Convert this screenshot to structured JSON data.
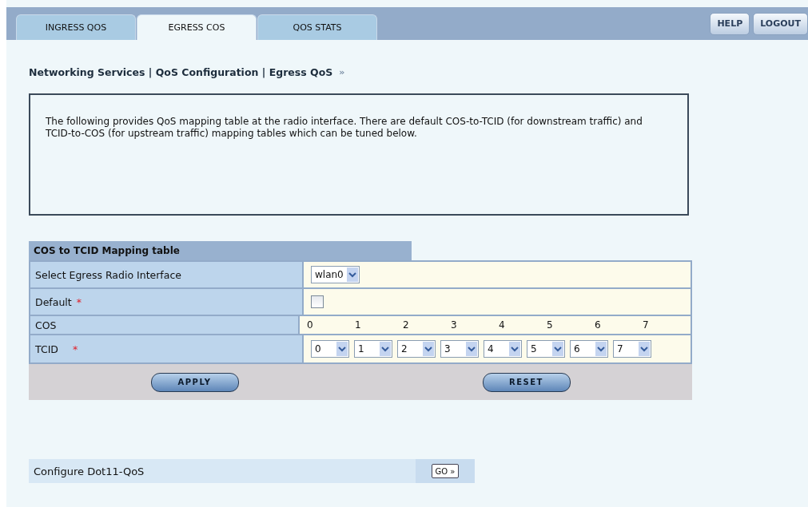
{
  "tabs": [
    {
      "label": "INGRESS QOS",
      "selected": false
    },
    {
      "label": "EGRESS COS",
      "selected": true
    },
    {
      "label": "QOS STATS",
      "selected": false
    }
  ],
  "header_buttons": [
    "HELP",
    "LOGOUT"
  ],
  "breadcrumb": {
    "text": "Networking Services | QoS Configuration | Egress QoS",
    "arrow": "»"
  },
  "description": "The following provides QoS mapping table at the radio interface. There are default COS-to-TCID (for downstream traffic) and TCID-to-COS (for upstream traffic) mapping tables which can be tuned below.",
  "mapping_table": {
    "title": "COS to TCID Mapping table",
    "rows": [
      {
        "kind": "select",
        "label": "Select Egress Radio Interface",
        "value": "wlan0"
      },
      {
        "kind": "checkbox",
        "label": "Default",
        "required": "*",
        "checked": false
      },
      {
        "kind": "numbers",
        "label": "COS",
        "values": [
          "0",
          "1",
          "2",
          "3",
          "4",
          "5",
          "6",
          "7"
        ]
      },
      {
        "kind": "selects",
        "label": "TCID",
        "required": "*",
        "values": [
          "0",
          "1",
          "2",
          "3",
          "4",
          "5",
          "6",
          "7"
        ]
      }
    ],
    "buttons": [
      "APPLY",
      "RESET"
    ]
  },
  "dot11": {
    "label": "Configure Dot11-QoS",
    "button": "GO »"
  }
}
